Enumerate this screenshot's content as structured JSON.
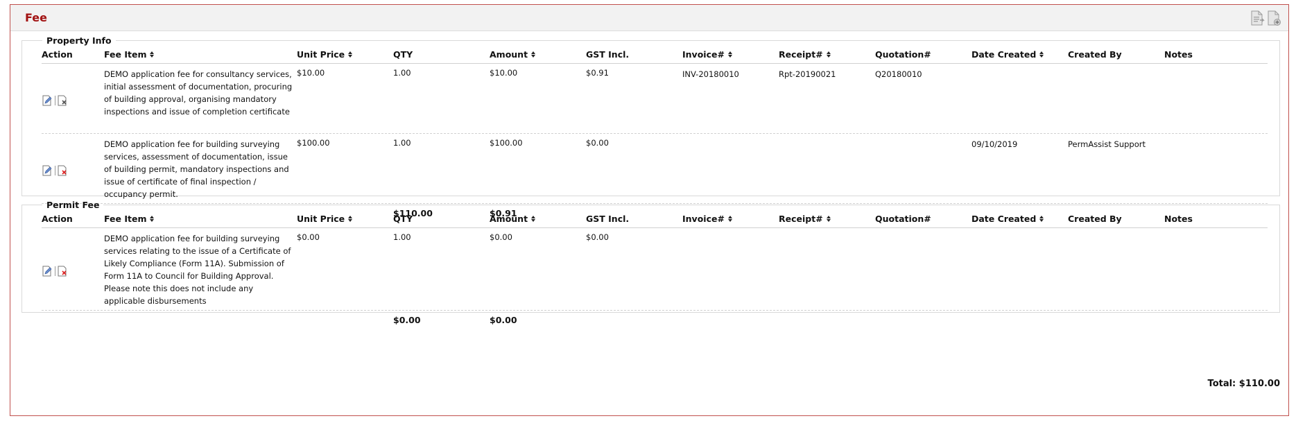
{
  "panel": {
    "title": "Fee"
  },
  "columns": {
    "action": "Action",
    "fee_item": "Fee Item",
    "unit_price": "Unit Price",
    "qty": "QTY",
    "amount": "Amount",
    "gst": "GST Incl.",
    "invoice": "Invoice#",
    "receipt": "Receipt#",
    "quotation": "Quotation#",
    "date_created": "Date Created",
    "created_by": "Created By",
    "notes": "Notes"
  },
  "groups": [
    {
      "legend": "Property Info",
      "rows": [
        {
          "fee_item": "DEMO application fee for consultancy services, initial assessment of documentation, procuring of building approval, organising mandatory inspections and issue of completion certificate",
          "unit_price": "$10.00",
          "qty": "1.00",
          "amount": "$10.00",
          "gst": "$0.91",
          "invoice": "INV-20180010",
          "receipt": "Rpt-20190021",
          "quotation": "Q20180010",
          "date_created": "",
          "created_by": "",
          "notes": ""
        },
        {
          "fee_item": "DEMO application fee for building surveying services, assessment of documentation, issue of building permit, mandatory inspections and issue of certificate of final inspection / occupancy permit.",
          "unit_price": "$100.00",
          "qty": "1.00",
          "amount": "$100.00",
          "gst": "$0.00",
          "invoice": "",
          "receipt": "",
          "quotation": "",
          "date_created": "09/10/2019",
          "created_by": "PermAssist Support",
          "notes": ""
        }
      ],
      "total_amount": "$110.00",
      "total_gst": "$0.91"
    },
    {
      "legend": "Permit Fee",
      "rows": [
        {
          "fee_item": "DEMO application fee for building surveying services relating to the issue of a Certificate of Likely Compliance (Form 11A). Submission of Form 11A to Council for Building Approval. Please note this does not include any applicable disbursements",
          "unit_price": "$0.00",
          "qty": "1.00",
          "amount": "$0.00",
          "gst": "$0.00",
          "invoice": "",
          "receipt": "",
          "quotation": "",
          "date_created": "",
          "created_by": "",
          "notes": ""
        }
      ],
      "total_amount": "$0.00",
      "total_gst": "$0.00"
    }
  ],
  "grand_total": "Total: $110.00",
  "icons": {
    "header": [
      "export-document-icon",
      "add-document-icon"
    ],
    "row_actions": [
      "edit-icon",
      "delete-icon"
    ]
  }
}
